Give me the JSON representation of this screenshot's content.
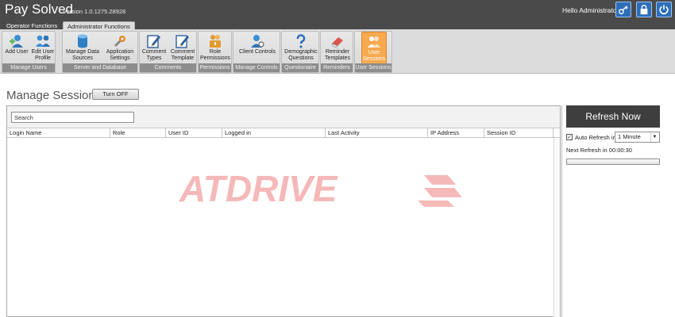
{
  "app": {
    "title": "Pay Solved",
    "version": "Version 1.0.1275.28928",
    "greeting": "Hello Administrator",
    "buttons": [
      {
        "name": "key-icon"
      },
      {
        "name": "lock-icon"
      },
      {
        "name": "power-icon"
      }
    ]
  },
  "tabs": [
    {
      "label": "Operator Functions",
      "active": false
    },
    {
      "label": "Administrator Functions",
      "active": true
    }
  ],
  "ribbon": {
    "groups": [
      {
        "label": "Manage Users",
        "buttons": [
          {
            "label": "Add User",
            "icon": "add-user-icon",
            "color": "#3c8fd6"
          },
          {
            "label": "Edit User\nProfile",
            "icon": "edit-user-icon",
            "color": "#3c8fd6"
          }
        ]
      },
      {
        "label": "Server and Database",
        "buttons": [
          {
            "label": "Manage Data\nSources",
            "icon": "database-icon",
            "color": "#2f7fc4"
          },
          {
            "label": "Application\nSettings",
            "icon": "wrench-icon",
            "color": "#e08b2b"
          }
        ]
      },
      {
        "label": "Comments",
        "buttons": [
          {
            "label": "Comment\nTypes",
            "icon": "pencil-icon",
            "color": "#2e5f9e"
          },
          {
            "label": "Comment\nTemplate",
            "icon": "pencil-icon",
            "color": "#2e5f9e"
          }
        ]
      },
      {
        "label": "Permissions",
        "buttons": [
          {
            "label": "Role\nPermissions",
            "icon": "lock-people-icon",
            "color": "#e39a2f"
          }
        ]
      },
      {
        "label": "Manage Controls",
        "buttons": [
          {
            "label": "Client Controls",
            "icon": "user-gear-icon",
            "color": "#3c8fd6"
          }
        ]
      },
      {
        "label": "Questionaire",
        "buttons": [
          {
            "label": "Demographic\nQuestions",
            "icon": "question-icon",
            "color": "#2e6fb8"
          }
        ]
      },
      {
        "label": "Reminders",
        "buttons": [
          {
            "label": "Reminder\nTemplates",
            "icon": "eraser-icon",
            "color": "#d9534f"
          }
        ]
      },
      {
        "label": "User Sessions",
        "buttons": [
          {
            "label": "User\nSessions",
            "icon": "user-sessions-icon",
            "color": "#f6a94e",
            "active": true
          }
        ]
      }
    ]
  },
  "main": {
    "title": "Manage Sessions",
    "toggle_label": "Turn OFF",
    "search_value": "Search",
    "columns": [
      "Login Name",
      "Role",
      "User ID",
      "Logged in",
      "Last Activity",
      "IP Address",
      "Session ID"
    ],
    "rows": []
  },
  "watermark": {
    "text": "ATDRIVE",
    "color": "#f08a8a"
  },
  "refresh": {
    "button_label": "Refresh Now",
    "auto_label": "Auto Refresh in",
    "auto_checked": true,
    "interval": "1 Minute",
    "next_label": "Next Refresh in 00:00:30",
    "progress": 0
  }
}
